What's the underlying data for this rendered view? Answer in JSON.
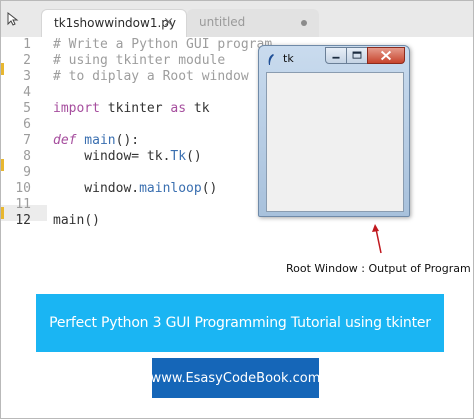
{
  "tabs": [
    {
      "label": "tk1showwindow1.py",
      "close_glyph": "×"
    },
    {
      "label": "untitled",
      "modified_glyph": "●"
    }
  ],
  "gutter": {
    "line_numbers": [
      "1",
      "2",
      "3",
      "4",
      "5",
      "6",
      "7",
      "8",
      "9",
      "10",
      "11",
      "12"
    ]
  },
  "code": {
    "line1": "# Write a Python GUI program",
    "line2": "# using tkinter module",
    "line3": "# to diplay a Root window",
    "line5_kw": "import",
    "line5_rest": " tkinter ",
    "line5_kw2": "as",
    "line5_rest2": " tk",
    "line7_kw": "def",
    "line7_fn": " main",
    "line7_rest": "():",
    "line8_a": "    window= tk.",
    "line8_fn": "Tk",
    "line8_b": "()",
    "line10_a": "    window.",
    "line10_fn": "mainloop",
    "line10_b": "()",
    "line12_a": "main",
    "line12_b": "()"
  },
  "tk_window": {
    "title": "tk",
    "icon": "feather-icon",
    "buttons": [
      "minimize-icon",
      "maximize-icon",
      "close-icon"
    ]
  },
  "annotation": {
    "caption": "Root Window : Output of Program",
    "arrow_color": "#c0181e"
  },
  "banner_title": {
    "text": "Perfect Python 3 GUI Programming Tutorial using tkinter",
    "color": "#1ab5f3"
  },
  "banner_site": {
    "text": "www.EsasyCodeBook.com",
    "color": "#1566b8"
  }
}
